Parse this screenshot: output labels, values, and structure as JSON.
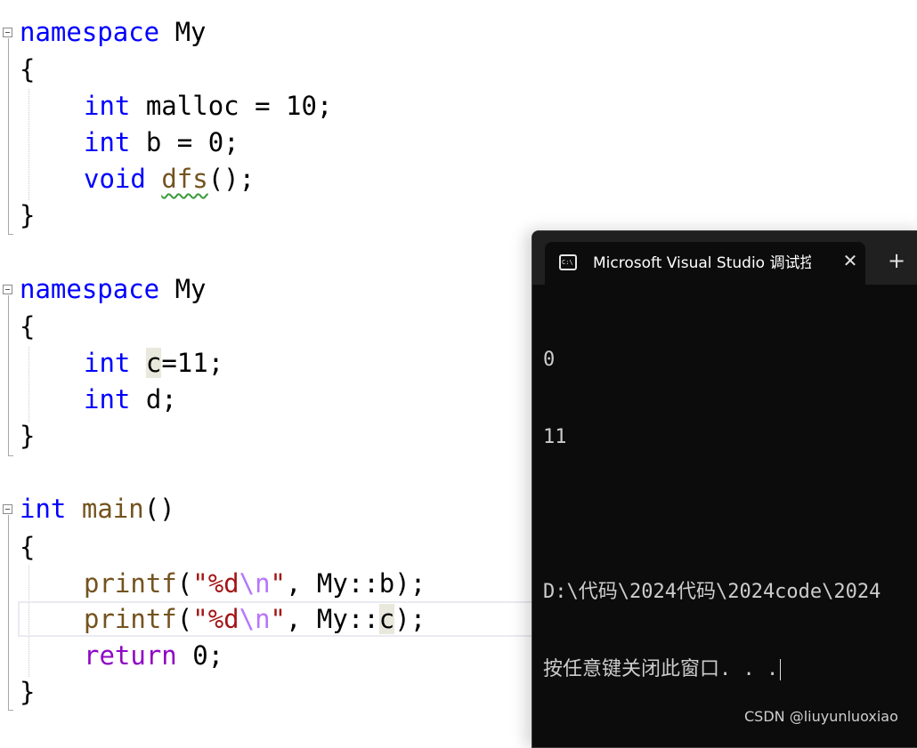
{
  "editor": {
    "lines": {
      "ns1_kw": "namespace",
      "ns1_name": " My",
      "ns1_open": "{",
      "l_malloc_type": "int",
      "l_malloc_rest": " malloc = 10;",
      "l_b_type": "int",
      "l_b_rest": " b = 0;",
      "l_dfs_type": "void",
      "l_dfs_sp": " ",
      "l_dfs_name": "dfs",
      "l_dfs_rest": "();",
      "ns1_close": "}",
      "ns2_kw": "namespace",
      "ns2_name": " My",
      "ns2_open": "{",
      "l_c_type": "int",
      "l_c_sp": " ",
      "l_c_name": "c",
      "l_c_rest": "=11;",
      "l_d_type": "int",
      "l_d_rest": " d;",
      "ns2_close": "}",
      "main_type": "int",
      "main_sp": " ",
      "main_name": "main",
      "main_rest": "()",
      "main_open": "{",
      "p1_fn": "printf",
      "p1_a": "(",
      "p1_str": "\"%d",
      "p1_esc": "\\n",
      "p1_q": "\"",
      "p1_rest": ", My::b);",
      "p2_fn": "printf",
      "p2_a": "(",
      "p2_str": "\"%d",
      "p2_esc": "\\n",
      "p2_q": "\"",
      "p2_mid": ", My::",
      "p2_c": "c",
      "p2_rest": ");",
      "ret_kw": "return",
      "ret_rest": " 0;",
      "main_close": "}"
    }
  },
  "console": {
    "tab_title": "Microsoft Visual Studio 调试控制台",
    "close_glyph": "✕",
    "new_tab_glyph": "+",
    "output": [
      "0",
      "11",
      "",
      "D:\\代码\\2024代码\\2024code\\2024",
      "按任意键关闭此窗口. . ."
    ]
  },
  "watermark": "CSDN @liuyunluoxiao",
  "colors": {
    "keyword": "#0000ff",
    "control_keyword": "#8f08c4",
    "function": "#74531f",
    "string": "#a31515",
    "escape": "#b776fb",
    "console_bg": "#0c0c0c",
    "console_text": "#cccccc"
  },
  "icons": [
    "fold-collapse-icon",
    "console-app-icon",
    "close-icon",
    "plus-icon"
  ]
}
